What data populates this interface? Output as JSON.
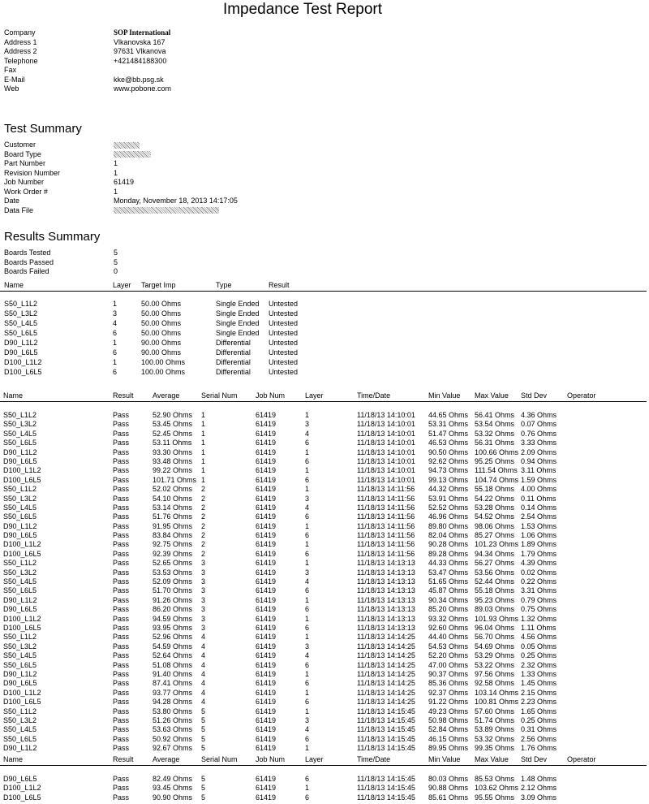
{
  "title": "Impedance Test Report",
  "company_info": [
    {
      "label": "Company",
      "value": "SOP International"
    },
    {
      "label": "Address 1",
      "value": "Vlkanovska 167"
    },
    {
      "label": "Address 2",
      "value": "97631 Vlkanova"
    },
    {
      "label": "Telephone",
      "value": "+421484188300"
    },
    {
      "label": "Fax",
      "value": ""
    },
    {
      "label": "E-Mail",
      "value": "kke@bb.psg.sk"
    },
    {
      "label": "Web",
      "value": "www.pobone.com"
    }
  ],
  "test_summary": {
    "heading": "Test Summary",
    "fields": [
      {
        "label": "Customer",
        "value": "",
        "redacted": true
      },
      {
        "label": "Board Type",
        "value": "",
        "redacted": true
      },
      {
        "label": "Part Number",
        "value": "1"
      },
      {
        "label": "Revision Number",
        "value": "1"
      },
      {
        "label": "Job Number",
        "value": "61419"
      },
      {
        "label": "Work Order #",
        "value": "1"
      },
      {
        "label": "Date",
        "value": "Monday, November 18, 2013 14:17:05"
      },
      {
        "label": "Data File",
        "value": "",
        "redacted": true
      }
    ]
  },
  "results_summary": {
    "heading": "Results Summary",
    "fields": [
      {
        "label": "Boards Tested",
        "value": "5"
      },
      {
        "label": "Boards Passed",
        "value": "5"
      },
      {
        "label": "Boards Failed",
        "value": "0"
      }
    ],
    "columns": [
      "Name",
      "Layer",
      "Target Imp",
      "Type",
      "Result"
    ],
    "rows": [
      [
        "S50_L1L2",
        "1",
        "50.00 Ohms",
        "Single Ended",
        "Untested"
      ],
      [
        "S50_L3L2",
        "3",
        "50.00 Ohms",
        "Single Ended",
        "Untested"
      ],
      [
        "S50_L4L5",
        "4",
        "50.00 Ohms",
        "Single Ended",
        "Untested"
      ],
      [
        "S50_L6L5",
        "6",
        "50.00 Ohms",
        "Single Ended",
        "Untested"
      ],
      [
        "D90_L1L2",
        "1",
        "90.00 Ohms",
        "Differential",
        "Untested"
      ],
      [
        "D90_L6L5",
        "6",
        "90.00 Ohms",
        "Differential",
        "Untested"
      ],
      [
        "D100_L1L2",
        "1",
        "100.00 Ohms",
        "Differential",
        "Untested"
      ],
      [
        "D100_L6L5",
        "6",
        "100.00 Ohms",
        "Differential",
        "Untested"
      ]
    ]
  },
  "results": {
    "columns": [
      "Name",
      "Result",
      "Average",
      "Serial Num",
      "Job Num",
      "Layer",
      "Time/Date",
      "Min Value",
      "Max Value",
      "Std Dev",
      "Operator"
    ],
    "rows": [
      [
        "S50_L1L2",
        "Pass",
        "52.90 Ohms",
        "1",
        "61419",
        "1",
        "11/18/13 14:10:01",
        "44.65 Ohms",
        "56.41 Ohms",
        "4.36 Ohms",
        ""
      ],
      [
        "S50_L3L2",
        "Pass",
        "53.45 Ohms",
        "1",
        "61419",
        "3",
        "11/18/13 14:10:01",
        "53.31 Ohms",
        "53.54 Ohms",
        "0.07 Ohms",
        ""
      ],
      [
        "S50_L4L5",
        "Pass",
        "52.45 Ohms",
        "1",
        "61419",
        "4",
        "11/18/13 14:10:01",
        "51.47 Ohms",
        "53.32 Ohms",
        "0.76 Ohms",
        ""
      ],
      [
        "S50_L6L5",
        "Pass",
        "53.11 Ohms",
        "1",
        "61419",
        "6",
        "11/18/13 14:10:01",
        "46.53 Ohms",
        "56.31 Ohms",
        "3.33 Ohms",
        ""
      ],
      [
        "D90_L1L2",
        "Pass",
        "93.30 Ohms",
        "1",
        "61419",
        "1",
        "11/18/13 14:10:01",
        "90.50 Ohms",
        "100.66 Ohms",
        "2.09 Ohms",
        ""
      ],
      [
        "D90_L6L5",
        "Pass",
        "93.48 Ohms",
        "1",
        "61419",
        "6",
        "11/18/13 14:10:01",
        "92.62 Ohms",
        "95.25 Ohms",
        "0.94 Ohms",
        ""
      ],
      [
        "D100_L1L2",
        "Pass",
        "99.22 Ohms",
        "1",
        "61419",
        "1",
        "11/18/13 14:10:01",
        "94.73 Ohms",
        "111.54 Ohms",
        "3.11 Ohms",
        ""
      ],
      [
        "D100_L6L5",
        "Pass",
        "101.71 Ohms",
        "1",
        "61419",
        "6",
        "11/18/13 14:10:01",
        "99.13 Ohms",
        "104.74 Ohms",
        "1.59 Ohms",
        ""
      ],
      [
        "S50_L1L2",
        "Pass",
        "52.02 Ohms",
        "2",
        "61419",
        "1",
        "11/18/13 14:11:56",
        "44.32 Ohms",
        "55.18 Ohms",
        "4.00 Ohms",
        ""
      ],
      [
        "S50_L3L2",
        "Pass",
        "54.10 Ohms",
        "2",
        "61419",
        "3",
        "11/18/13 14:11:56",
        "53.91 Ohms",
        "54.22 Ohms",
        "0.11 Ohms",
        ""
      ],
      [
        "S50_L4L5",
        "Pass",
        "53.14 Ohms",
        "2",
        "61419",
        "4",
        "11/18/13 14:11:56",
        "52.52 Ohms",
        "53.28 Ohms",
        "0.14 Ohms",
        ""
      ],
      [
        "S50_L6L5",
        "Pass",
        "51.76 Ohms",
        "2",
        "61419",
        "6",
        "11/18/13 14:11:56",
        "46.96 Ohms",
        "54.52 Ohms",
        "2.54 Ohms",
        ""
      ],
      [
        "D90_L1L2",
        "Pass",
        "91.95 Ohms",
        "2",
        "61419",
        "1",
        "11/18/13 14:11:56",
        "89.80 Ohms",
        "98.06 Ohms",
        "1.53 Ohms",
        ""
      ],
      [
        "D90_L6L5",
        "Pass",
        "83.84 Ohms",
        "2",
        "61419",
        "6",
        "11/18/13 14:11:56",
        "82.04 Ohms",
        "85.27 Ohms",
        "1.06 Ohms",
        ""
      ],
      [
        "D100_L1L2",
        "Pass",
        "92.75 Ohms",
        "2",
        "61419",
        "1",
        "11/18/13 14:11:56",
        "90.28 Ohms",
        "101.23 Ohms",
        "1.89 Ohms",
        ""
      ],
      [
        "D100_L6L5",
        "Pass",
        "92.39 Ohms",
        "2",
        "61419",
        "6",
        "11/18/13 14:11:56",
        "89.28 Ohms",
        "94.34 Ohms",
        "1.79 Ohms",
        ""
      ],
      [
        "S50_L1L2",
        "Pass",
        "52.65 Ohms",
        "3",
        "61419",
        "1",
        "11/18/13 14:13:13",
        "44.33 Ohms",
        "56.27 Ohms",
        "4.39 Ohms",
        ""
      ],
      [
        "S50_L3L2",
        "Pass",
        "53.53 Ohms",
        "3",
        "61419",
        "3",
        "11/18/13 14:13:13",
        "53.47 Ohms",
        "53.56 Ohms",
        "0.02 Ohms",
        ""
      ],
      [
        "S50_L4L5",
        "Pass",
        "52.09 Ohms",
        "3",
        "61419",
        "4",
        "11/18/13 14:13:13",
        "51.65 Ohms",
        "52.44 Ohms",
        "0.22 Ohms",
        ""
      ],
      [
        "S50_L6L5",
        "Pass",
        "51.70 Ohms",
        "3",
        "61419",
        "6",
        "11/18/13 14:13:13",
        "45.87 Ohms",
        "55.18 Ohms",
        "3.31 Ohms",
        ""
      ],
      [
        "D90_L1L2",
        "Pass",
        "91.26 Ohms",
        "3",
        "61419",
        "1",
        "11/18/13 14:13:13",
        "90.34 Ohms",
        "95.23 Ohms",
        "0.79 Ohms",
        ""
      ],
      [
        "D90_L6L5",
        "Pass",
        "86.20 Ohms",
        "3",
        "61419",
        "6",
        "11/18/13 14:13:13",
        "85.20 Ohms",
        "89.03 Ohms",
        "0.75 Ohms",
        ""
      ],
      [
        "D100_L1L2",
        "Pass",
        "94.59 Ohms",
        "3",
        "61419",
        "1",
        "11/18/13 14:13:13",
        "93.32 Ohms",
        "101.93 Ohms",
        "1.32 Ohms",
        ""
      ],
      [
        "D100_L6L5",
        "Pass",
        "93.95 Ohms",
        "3",
        "61419",
        "6",
        "11/18/13 14:13:13",
        "92.60 Ohms",
        "96.04 Ohms",
        "1.11 Ohms",
        ""
      ],
      [
        "S50_L1L2",
        "Pass",
        "52.96 Ohms",
        "4",
        "61419",
        "1",
        "11/18/13 14:14:25",
        "44.40 Ohms",
        "56.70 Ohms",
        "4.56 Ohms",
        ""
      ],
      [
        "S50_L3L2",
        "Pass",
        "54.59 Ohms",
        "4",
        "61419",
        "3",
        "11/18/13 14:14:25",
        "54.53 Ohms",
        "54.69 Ohms",
        "0.05 Ohms",
        ""
      ],
      [
        "S50_L4L5",
        "Pass",
        "52.64 Ohms",
        "4",
        "61419",
        "4",
        "11/18/13 14:14:25",
        "52.20 Ohms",
        "53.29 Ohms",
        "0.25 Ohms",
        ""
      ],
      [
        "S50_L6L5",
        "Pass",
        "51.08 Ohms",
        "4",
        "61419",
        "6",
        "11/18/13 14:14:25",
        "47.00 Ohms",
        "53.22 Ohms",
        "2.32 Ohms",
        ""
      ],
      [
        "D90_L1L2",
        "Pass",
        "91.40 Ohms",
        "4",
        "61419",
        "1",
        "11/18/13 14:14:25",
        "90.37 Ohms",
        "97.56 Ohms",
        "1.33 Ohms",
        ""
      ],
      [
        "D90_L6L5",
        "Pass",
        "87.41 Ohms",
        "4",
        "61419",
        "6",
        "11/18/13 14:14:25",
        "85.36 Ohms",
        "92.58 Ohms",
        "1.45 Ohms",
        ""
      ],
      [
        "D100_L1L2",
        "Pass",
        "93.77 Ohms",
        "4",
        "61419",
        "1",
        "11/18/13 14:14:25",
        "92.37 Ohms",
        "103.14 Ohms",
        "2.15 Ohms",
        ""
      ],
      [
        "D100_L6L5",
        "Pass",
        "94.28 Ohms",
        "4",
        "61419",
        "6",
        "11/18/13 14:14:25",
        "91.22 Ohms",
        "100.81 Ohms",
        "2.23 Ohms",
        ""
      ],
      [
        "S50_L1L2",
        "Pass",
        "53.80 Ohms",
        "5",
        "61419",
        "1",
        "11/18/13 14:15:45",
        "49.23 Ohms",
        "57.60 Ohms",
        "1.65 Ohms",
        ""
      ],
      [
        "S50_L3L2",
        "Pass",
        "51.26 Ohms",
        "5",
        "61419",
        "3",
        "11/18/13 14:15:45",
        "50.98 Ohms",
        "51.74 Ohms",
        "0.25 Ohms",
        ""
      ],
      [
        "S50_L4L5",
        "Pass",
        "53.63 Ohms",
        "5",
        "61419",
        "4",
        "11/18/13 14:15:45",
        "52.84 Ohms",
        "53.89 Ohms",
        "0.31 Ohms",
        ""
      ],
      [
        "S50_L6L5",
        "Pass",
        "50.92 Ohms",
        "5",
        "61419",
        "6",
        "11/18/13 14:15:45",
        "46.15 Ohms",
        "53.32 Ohms",
        "2.56 Ohms",
        ""
      ],
      [
        "D90_L1L2",
        "Pass",
        "92.67 Ohms",
        "5",
        "61419",
        "1",
        "11/18/13 14:15:45",
        "89.95 Ohms",
        "99.35 Ohms",
        "1.76 Ohms",
        ""
      ]
    ],
    "continued_rows": [
      [
        "D90_L6L5",
        "Pass",
        "82.49 Ohms",
        "5",
        "61419",
        "6",
        "11/18/13 14:15:45",
        "80.03 Ohms",
        "85.53 Ohms",
        "1.48 Ohms",
        ""
      ],
      [
        "D100_L1L2",
        "Pass",
        "93.45 Ohms",
        "5",
        "61419",
        "1",
        "11/18/13 14:15:45",
        "90.88 Ohms",
        "103.62 Ohms",
        "2.12 Ohms",
        ""
      ],
      [
        "D100_L6L5",
        "Pass",
        "90.90 Ohms",
        "5",
        "61419",
        "6",
        "11/18/13 14:15:45",
        "85.61 Ohms",
        "95.55 Ohms",
        "3.09 Ohms",
        ""
      ]
    ]
  }
}
